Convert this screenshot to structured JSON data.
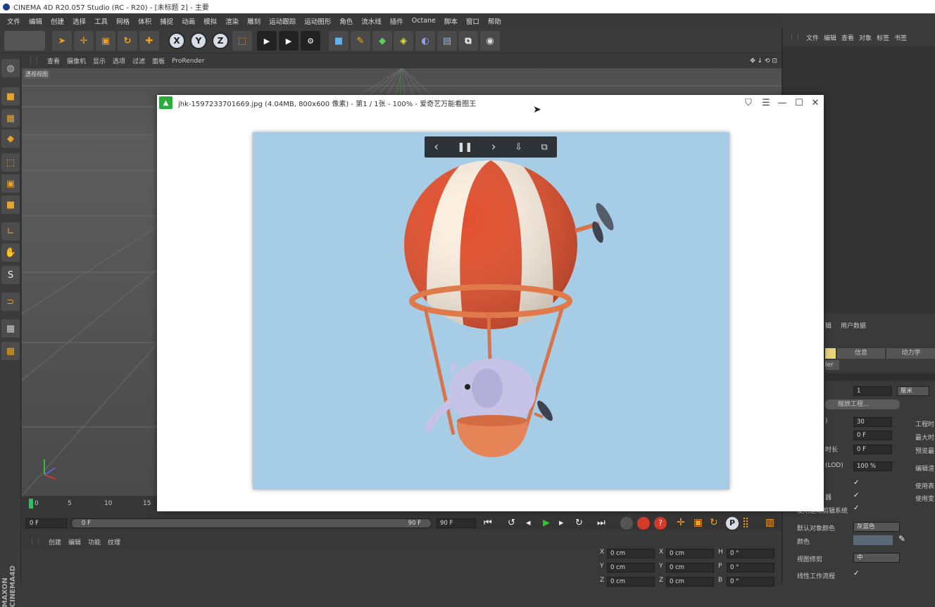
{
  "app": {
    "title": "CINEMA 4D R20.057 Studio (RC - R20) - [未标题 2] - 主要"
  },
  "menu": [
    "文件",
    "编辑",
    "创建",
    "选择",
    "工具",
    "网格",
    "体积",
    "捕捉",
    "动画",
    "模拟",
    "渲染",
    "雕刻",
    "运动跟踪",
    "运动图形",
    "角色",
    "流水线",
    "插件",
    "Octane",
    "脚本",
    "窗口",
    "帮助"
  ],
  "toolbar": {
    "axis_x": "X",
    "axis_y": "Y",
    "axis_z": "Z"
  },
  "viewport": {
    "menu": [
      "查看",
      "摄像机",
      "显示",
      "选项",
      "过滤",
      "面板",
      "ProRender"
    ],
    "label": "透视视图"
  },
  "timeline": {
    "ticks": [
      "0",
      "5",
      "10",
      "15"
    ],
    "start": "0 F",
    "range_start": "0 F",
    "range_end": "90 F",
    "end": "90 F"
  },
  "material": {
    "menu": [
      "创建",
      "编辑",
      "功能",
      "纹理"
    ]
  },
  "coords": {
    "rows": [
      {
        "a": "X",
        "av": "0 cm",
        "b": "X",
        "bv": "0 cm",
        "c": "H",
        "cv": "0 °"
      },
      {
        "a": "Y",
        "av": "0 cm",
        "b": "Y",
        "bv": "0 cm",
        "c": "P",
        "cv": "0 °"
      },
      {
        "a": "Z",
        "av": "0 cm",
        "b": "Z",
        "bv": "0 cm",
        "c": "B",
        "cv": "0 °"
      }
    ]
  },
  "objects": {
    "tabs": [
      "文件",
      "编辑",
      "查看",
      "对象",
      "标签",
      "书签"
    ]
  },
  "attributes": {
    "tabs": [
      "辑",
      "用户数据"
    ],
    "subtabs": [
      "信息",
      "动力学"
    ],
    "sub_label": "ler",
    "scale_value": "1",
    "scale_unit": "厘米",
    "scale_button": "缩放工程...",
    "fps_label": ")",
    "fps": "30",
    "frame_a": "0 F",
    "frame_b": "0 F",
    "preview_label": "时长",
    "lod_label": "(LOD)",
    "lod": "100 %",
    "right_labels": [
      "工程时",
      "最大时",
      "预览最",
      "编辑渲",
      "使用表",
      "使用变"
    ],
    "row_mid": "器",
    "use_anim_label": "使用运动剪辑系统",
    "default_color_label": "默认对象颜色",
    "default_color": "灰蓝色",
    "color_label": "颜色",
    "view_clip_label": "视图修剪",
    "view_clip": "中",
    "linear_label": "线性工作流程",
    "check": "✓"
  },
  "viewer": {
    "title": "jhk-1597233701669.jpg (4.04MB, 800x600 像素) - 第1 / 1张 - 100% - 爱奇艺万能看图王",
    "controls": {
      "prev": "‹",
      "pause": "❚❚",
      "next": "›"
    }
  },
  "colors": {
    "accent": "#f0a020",
    "photo_bg": "#a7cde6",
    "viewer_logo": "#2bab3b"
  }
}
